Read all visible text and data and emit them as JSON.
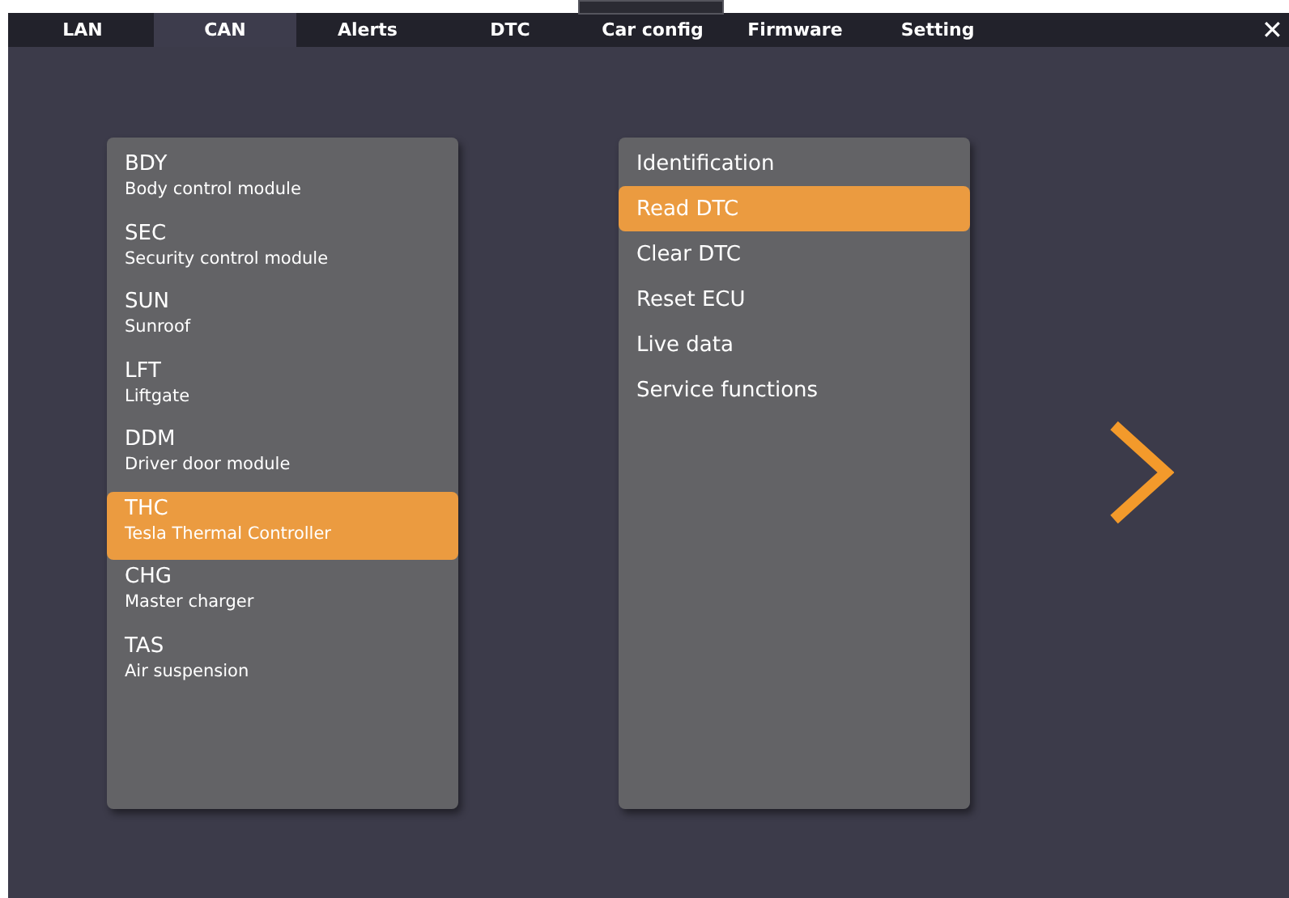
{
  "tabs": [
    {
      "label": "LAN",
      "selected": false
    },
    {
      "label": "CAN",
      "selected": true
    },
    {
      "label": "Alerts",
      "selected": false
    },
    {
      "label": "DTC",
      "selected": false
    },
    {
      "label": "Car config",
      "selected": false
    },
    {
      "label": "Firmware",
      "selected": false
    },
    {
      "label": "Setting",
      "selected": false
    }
  ],
  "close": "✕",
  "modules": [
    {
      "code": "BDY",
      "name": "Body control module",
      "selected": false
    },
    {
      "code": "SEC",
      "name": "Security control module",
      "selected": false
    },
    {
      "code": "SUN",
      "name": "Sunroof",
      "selected": false
    },
    {
      "code": "LFT",
      "name": "Liftgate",
      "selected": false
    },
    {
      "code": "DDM",
      "name": "Driver door module",
      "selected": false
    },
    {
      "code": "THC",
      "name": "Tesla Thermal Controller",
      "selected": true
    },
    {
      "code": "CHG",
      "name": "Master charger",
      "selected": false
    },
    {
      "code": "TAS",
      "name": "Air suspension",
      "selected": false
    }
  ],
  "actions": [
    {
      "label": "Identification",
      "selected": false
    },
    {
      "label": "Read DTC",
      "selected": true
    },
    {
      "label": "Clear DTC",
      "selected": false
    },
    {
      "label": "Reset ECU",
      "selected": false
    },
    {
      "label": "Live data",
      "selected": false
    },
    {
      "label": "Service functions",
      "selected": false
    }
  ]
}
